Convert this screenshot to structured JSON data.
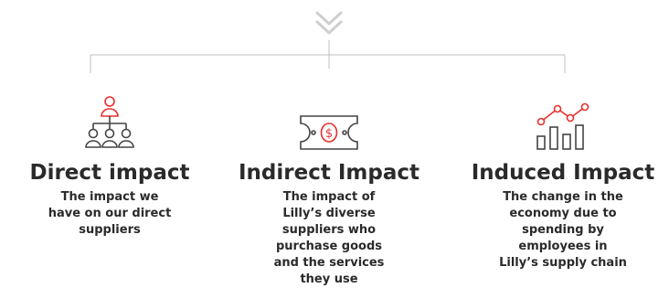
{
  "items": [
    {
      "title": "Direct impact",
      "description": "The impact we have on our direct suppliers",
      "icon": "org-chart-people-icon"
    },
    {
      "title": "Indirect Impact",
      "description": "The impact of Lilly’s diverse suppliers who purchase goods and the services they use",
      "icon": "money-bill-icon"
    },
    {
      "title": "Induced Impact",
      "description": "The change in the economy due to spending by employees in Lilly’s supply chain",
      "icon": "growth-chart-icon"
    }
  ],
  "colors": {
    "accent": "#e8312f",
    "line": "#bfbfbf",
    "chevron": "#cfcfcf",
    "text": "#2a2a2a"
  }
}
